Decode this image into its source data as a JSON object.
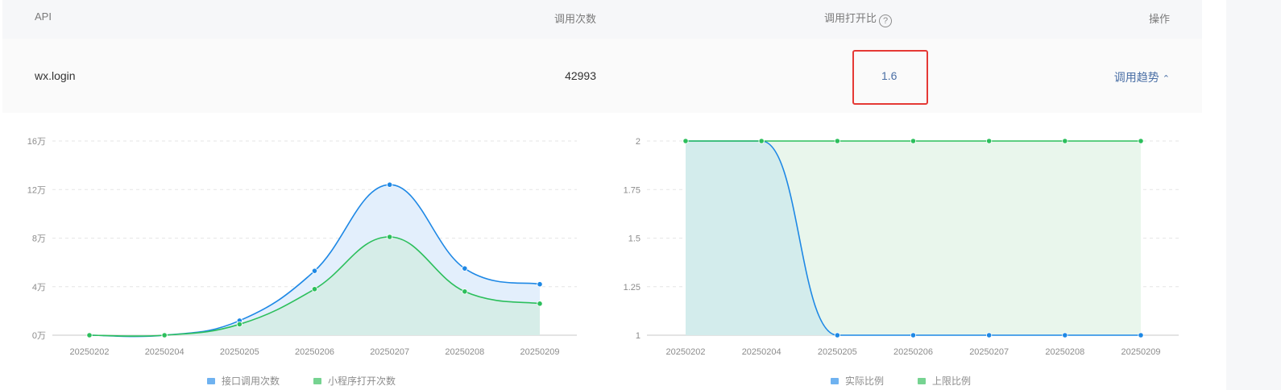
{
  "table": {
    "headers": {
      "api": "API",
      "calls": "调用次数",
      "ratio": "调用打开比",
      "ops": "操作"
    },
    "help_glyph": "?",
    "row": {
      "api": "wx.login",
      "calls": "42993",
      "ratio": "1.6",
      "trend_label": "调用趋势",
      "chevron": "^"
    }
  },
  "chart_data": [
    {
      "type": "area",
      "categories": [
        "20250202",
        "20250204",
        "20250205",
        "20250206",
        "20250207",
        "20250208",
        "20250209"
      ],
      "series": [
        {
          "name": "接口调用次数",
          "color": "#1e88e5",
          "fill": "#e3effc",
          "values": [
            0,
            0,
            1.2,
            5.3,
            12.4,
            5.5,
            4.2
          ]
        },
        {
          "name": "小程序打开次数",
          "color": "#2cbf5c",
          "fill": "#d6ede8",
          "values": [
            0,
            0,
            0.9,
            3.8,
            8.1,
            3.6,
            2.6
          ]
        }
      ],
      "ylim": [
        0,
        16
      ],
      "yticks": [
        "0万",
        "4万",
        "8万",
        "12万",
        "16万"
      ],
      "ytick_values": [
        0,
        4,
        8,
        12,
        16
      ],
      "grid": true,
      "legend": "bottom"
    },
    {
      "type": "area",
      "categories": [
        "20250202",
        "20250204",
        "20250205",
        "20250206",
        "20250207",
        "20250208",
        "20250209"
      ],
      "series": [
        {
          "name": "实际比例",
          "color": "#1e88e5",
          "fill": "#d3ecec",
          "values": [
            2,
            2,
            1,
            1,
            1,
            1,
            1
          ]
        },
        {
          "name": "上限比例",
          "color": "#2cbf5c",
          "fill": "#e9f6ec",
          "values": [
            2,
            2,
            2,
            2,
            2,
            2,
            2
          ]
        }
      ],
      "ylim": [
        1,
        2
      ],
      "yticks": [
        "1",
        "1.25",
        "1.5",
        "1.75",
        "2"
      ],
      "ytick_values": [
        1,
        1.25,
        1.5,
        1.75,
        2
      ],
      "grid": true,
      "legend": "bottom"
    }
  ]
}
